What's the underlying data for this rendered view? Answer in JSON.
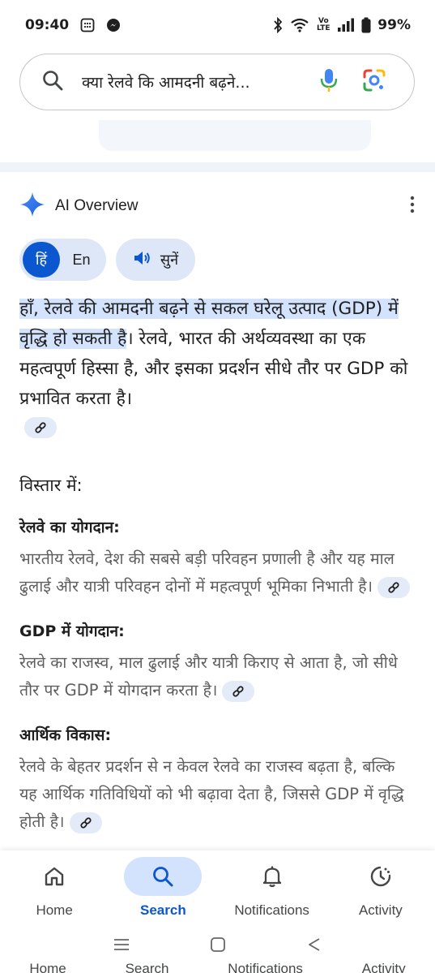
{
  "status_bar": {
    "time": "09:40",
    "volte": "Vo LTE",
    "battery": "99%"
  },
  "search": {
    "query": "क्या रेलवे कि आमदनी बढ़ने..."
  },
  "ai_overview": {
    "title": "AI Overview",
    "lang_hindi": "हिं",
    "lang_english": "En",
    "listen_label": "सुनें",
    "intro_highlight": "हाँ, रेलवे की आमदनी बढ़ने से सकल घरेलू उत्पाद (GDP) में वृद्धि हो सकती है",
    "intro_rest": "। रेलवे, भारत की अर्थव्यवस्था का एक महत्वपूर्ण हिस्सा है, और इसका प्रदर्शन सीधे तौर पर GDP को प्रभावित करता है।",
    "section_heading": "विस्तार में:",
    "points": [
      {
        "heading": "रेलवे का योगदान:",
        "text": "भारतीय रेलवे, देश की सबसे बड़ी परिवहन प्रणाली है और यह माल ढुलाई और यात्री परिवहन दोनों में महत्वपूर्ण भूमिका निभाती है।"
      },
      {
        "heading": "GDP में योगदान:",
        "text": "रेलवे का राजस्व, माल ढुलाई और यात्री किराए से आता है, जो सीधे तौर पर GDP में योगदान करता है।"
      },
      {
        "heading": "आर्थिक विकास:",
        "text": "रेलवे के बेहतर प्रदर्शन से न केवल रेलवे का राजस्व बढ़ता है, बल्कि यह आर्थिक गतिविधियों को भी बढ़ावा देता है, जिससे GDP में वृद्धि होती है।"
      }
    ]
  },
  "bottom_nav": {
    "items": [
      {
        "label": "Home",
        "icon": "home-icon"
      },
      {
        "label": "Search",
        "icon": "search-icon",
        "active": true
      },
      {
        "label": "Notifications",
        "icon": "bell-icon"
      },
      {
        "label": "Activity",
        "icon": "activity-icon"
      }
    ]
  },
  "colors": {
    "accent": "#0b57d0",
    "highlight": "#d3e3fd",
    "chip": "#dde7f8"
  }
}
